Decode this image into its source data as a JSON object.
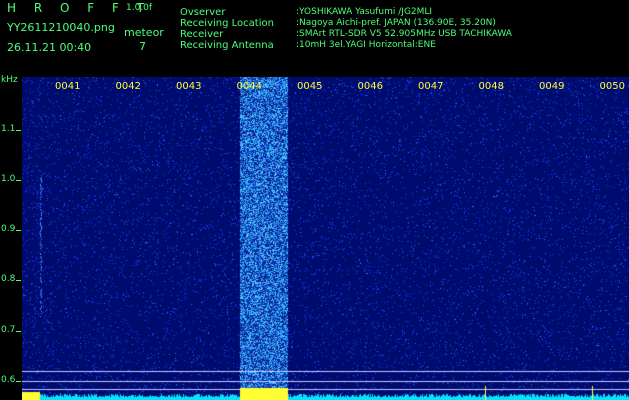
{
  "header": {
    "app_title": "H R O F F T",
    "app_version": "1.0.0f",
    "filename": "YY2611210040.png",
    "timestamp": "26.11.21 00:40",
    "meteor_label": "meteor",
    "meteor_count": "7",
    "info": [
      {
        "label": "Ovserver",
        "value": ":YOSHIKAWA Yasufumi /JG2MLI"
      },
      {
        "label": "Receiving Location",
        "value": ":Nagoya Aichi-pref. JAPAN (136.90E, 35.20N)"
      },
      {
        "label": "Receiver",
        "value": ":SMArt RTL-SDR V5 52.905MHz USB TACHIKAWA"
      },
      {
        "label": "Receiving Antenna",
        "value": ":10mH 3el.YAGI Horizontal:ENE"
      }
    ]
  },
  "spectrogram": {
    "unit": "kHz",
    "y_ticks": [
      "1.1",
      "1.0",
      "0.9",
      "0.8",
      "0.7",
      "0.6"
    ],
    "y_range": [
      0.58,
      1.18
    ],
    "x_ticks": [
      "0041",
      "0042",
      "0043",
      "0044",
      "0045",
      "0046",
      "0047",
      "0048",
      "0049",
      "0050"
    ],
    "colors": {
      "background": "#000b6e",
      "noise": "#1a3cff",
      "signal": "#35d0ff",
      "hot": "#ffff33",
      "baseline": "#00e5ff",
      "marker": "#c8c8ff"
    }
  }
}
